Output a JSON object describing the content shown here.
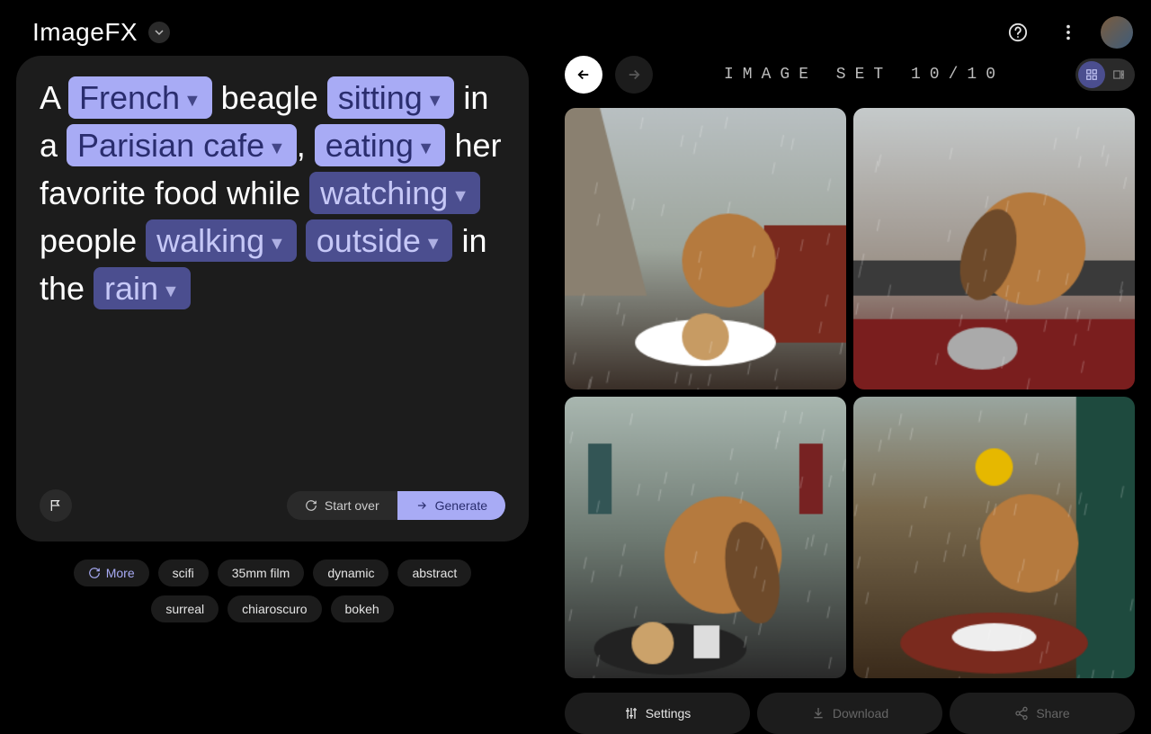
{
  "header": {
    "app_title": "ImageFX"
  },
  "prompt": {
    "tokens": [
      {
        "kind": "text",
        "value": "A "
      },
      {
        "kind": "chip",
        "style": "primary",
        "value": "French"
      },
      {
        "kind": "text",
        "value": " beagle "
      },
      {
        "kind": "chip",
        "style": "primary",
        "value": "sitting"
      },
      {
        "kind": "text",
        "value": " in a "
      },
      {
        "kind": "chip",
        "style": "primary",
        "value": "Parisian cafe"
      },
      {
        "kind": "text",
        "value": ", "
      },
      {
        "kind": "chip",
        "style": "primary",
        "value": "eating"
      },
      {
        "kind": "text",
        "value": " her favorite food while "
      },
      {
        "kind": "chip",
        "style": "secondary",
        "value": "watching"
      },
      {
        "kind": "text",
        "value": " people "
      },
      {
        "kind": "chip",
        "style": "secondary",
        "value": "walking"
      },
      {
        "kind": "text",
        "value": " "
      },
      {
        "kind": "chip",
        "style": "secondary",
        "value": "outside"
      },
      {
        "kind": "text",
        "value": " in the "
      },
      {
        "kind": "chip",
        "style": "secondary",
        "value": "rain"
      }
    ],
    "start_over": "Start over",
    "generate": "Generate"
  },
  "styles": {
    "more": "More",
    "items": [
      "scifi",
      "35mm film",
      "dynamic",
      "abstract",
      "surreal",
      "chiaroscuro",
      "bokeh"
    ]
  },
  "results": {
    "set_label": "IMAGE SET 10/10",
    "settings": "Settings",
    "download": "Download",
    "share": "Share"
  }
}
